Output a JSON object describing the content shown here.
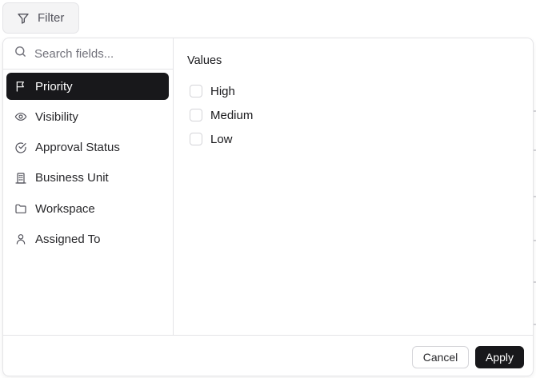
{
  "filter_button": {
    "label": "Filter",
    "icon": "funnel-icon"
  },
  "search": {
    "placeholder": "Search fields...",
    "value": ""
  },
  "fields": [
    {
      "label": "Priority",
      "icon": "flag-icon",
      "selected": true
    },
    {
      "label": "Visibility",
      "icon": "eye-icon",
      "selected": false
    },
    {
      "label": "Approval Status",
      "icon": "check-circle-icon",
      "selected": false
    },
    {
      "label": "Business Unit",
      "icon": "building-icon",
      "selected": false
    },
    {
      "label": "Workspace",
      "icon": "folder-icon",
      "selected": false
    },
    {
      "label": "Assigned To",
      "icon": "user-icon",
      "selected": false
    }
  ],
  "values_panel": {
    "title": "Values",
    "options": [
      {
        "label": "High",
        "checked": false
      },
      {
        "label": "Medium",
        "checked": false
      },
      {
        "label": "Low",
        "checked": false
      }
    ]
  },
  "footer": {
    "cancel_label": "Cancel",
    "apply_label": "Apply"
  },
  "colors": {
    "accent": "#18181b",
    "border": "#e4e4e7",
    "muted_text": "#71717a"
  }
}
